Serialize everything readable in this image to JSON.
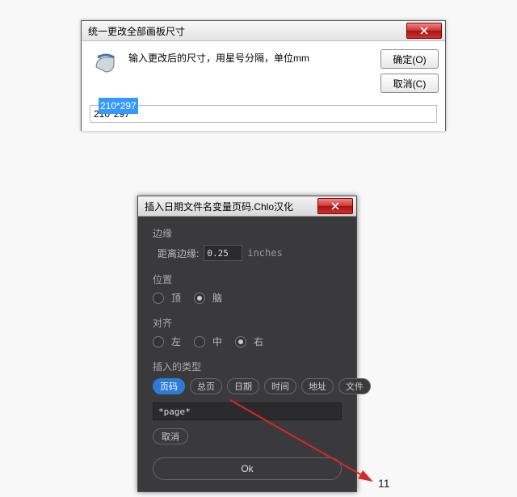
{
  "dialog1": {
    "title": "统一更改全部画板尺寸",
    "message": "输入更改后的尺寸，用星号分隔，单位mm",
    "okLabel": "确定(O)",
    "cancelLabel": "取消(C)",
    "inputValue": "210*297"
  },
  "dialog2": {
    "title": "插入日期文件名变量页码.Chlo汉化",
    "marginSection": "边缘",
    "marginLabel": "距离边缘:",
    "marginValue": "0.25",
    "marginUnit": "inches",
    "positionSection": "位置",
    "posOptions": [
      "顶",
      "脑"
    ],
    "posSelected": 1,
    "alignSection": "对齐",
    "alignOptions": [
      "左",
      "中",
      "右"
    ],
    "alignSelected": 2,
    "typeSection": "插入的类型",
    "chips": [
      "页码",
      "总页",
      "日期",
      "时间",
      "地址",
      "文件"
    ],
    "chipSelected": 0,
    "insertText": "*page*",
    "cancelLabel": "取消",
    "okLabel": "Ok"
  },
  "pageNumber": "11"
}
